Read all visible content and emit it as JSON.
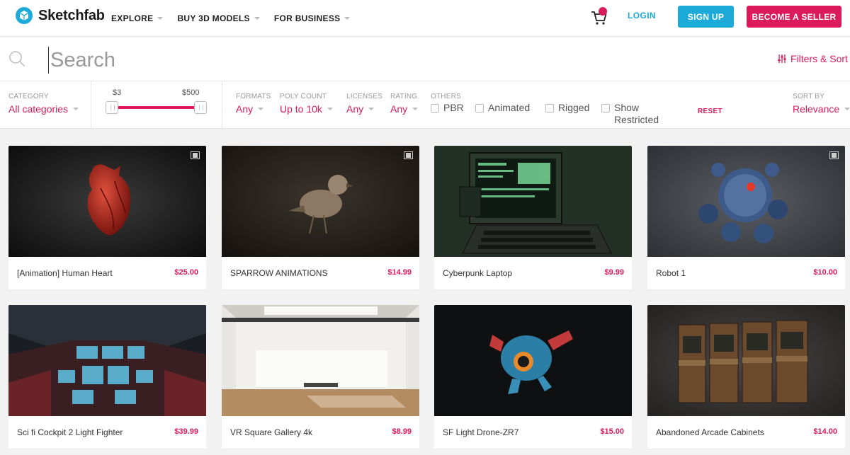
{
  "brand": {
    "name": "Sketchfab",
    "accent": "#1caad9",
    "highlight": "#dc1a5b"
  },
  "nav": {
    "items": [
      {
        "label": "EXPLORE"
      },
      {
        "label": "BUY 3D MODELS"
      },
      {
        "label": "FOR BUSINESS"
      }
    ],
    "cart_icon": "shopping-cart-icon",
    "login_label": "LOGIN",
    "signup_label": "SIGN UP",
    "seller_label": "BECOME A SELLER"
  },
  "search": {
    "placeholder": "Search",
    "filters_sort_label": "Filters & Sort"
  },
  "filters": {
    "category": {
      "label": "CATEGORY",
      "value": "All categories"
    },
    "price": {
      "min": "$3",
      "max": "$500"
    },
    "formats": {
      "label": "FORMATS",
      "value": "Any"
    },
    "poly_count": {
      "label": "POLY COUNT",
      "value": "Up to 10k"
    },
    "licenses": {
      "label": "LICENSES",
      "value": "Any"
    },
    "rating": {
      "label": "RATING",
      "value": "Any"
    },
    "others": {
      "label": "OTHERS",
      "options": [
        {
          "label": "PBR",
          "checked": false
        },
        {
          "label": "Animated",
          "checked": false
        },
        {
          "label": "Rigged",
          "checked": false
        },
        {
          "label": "Show Restricted",
          "checked": false
        }
      ]
    },
    "reset_label": "RESET",
    "sort_by": {
      "label": "SORT BY",
      "value": "Relevance"
    }
  },
  "models": [
    {
      "title": "[Animation] Human Heart",
      "price": "$25.00",
      "animated": true
    },
    {
      "title": "SPARROW ANIMATIONS",
      "price": "$14.99",
      "animated": true
    },
    {
      "title": "Cyberpunk Laptop",
      "price": "$9.99",
      "animated": false
    },
    {
      "title": "Robot 1",
      "price": "$10.00",
      "animated": true
    },
    {
      "title": "Sci fi Cockpit 2 Light Fighter",
      "price": "$39.99",
      "animated": false
    },
    {
      "title": "VR Square Gallery 4k",
      "price": "$8.99",
      "animated": false
    },
    {
      "title": "SF Light Drone-ZR7",
      "price": "$15.00",
      "animated": false
    },
    {
      "title": "Abandoned Arcade Cabinets",
      "price": "$14.00",
      "animated": false
    }
  ]
}
